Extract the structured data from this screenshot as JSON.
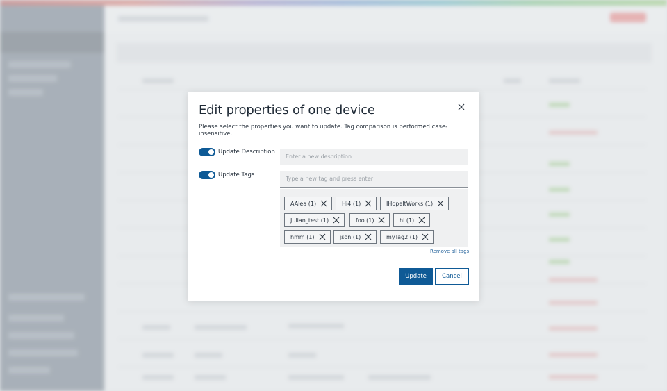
{
  "modal": {
    "title": "Edit properties of one device",
    "description": "Please select the properties you want to update. Tag comparison is performed case-insensitive.",
    "close_icon": "close-icon"
  },
  "description_toggle": {
    "label": "Update Description",
    "enabled": true
  },
  "description_input": {
    "value": "",
    "placeholder": "Enter a new description"
  },
  "tags_toggle": {
    "label": "Update Tags",
    "enabled": true
  },
  "tags_input": {
    "value": "",
    "placeholder": "Type a new tag and press enter"
  },
  "tags": [
    {
      "label": "AAlea (1)"
    },
    {
      "label": "Hi4 (1)"
    },
    {
      "label": "IHopeItWorks (1)"
    },
    {
      "label": "Julian_test (1)"
    },
    {
      "label": "foo (1)"
    },
    {
      "label": "hi (1)"
    },
    {
      "label": "hmm (1)"
    },
    {
      "label": "json (1)"
    },
    {
      "label": "myTag2 (1)"
    }
  ],
  "remove_all_label": "Remove all tags",
  "buttons": {
    "update": "Update",
    "cancel": "Cancel"
  },
  "colors": {
    "primary": "#0f5a96",
    "toggle_on": "#0e5a96",
    "link": "#1f5f99"
  }
}
